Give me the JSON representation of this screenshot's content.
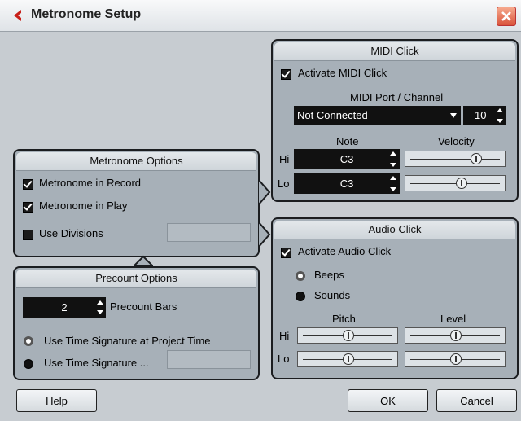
{
  "window": {
    "title": "Metronome Setup"
  },
  "metronome_options": {
    "header": "Metronome Options",
    "record": {
      "label": "Metronome in Record",
      "checked": true
    },
    "play": {
      "label": "Metronome in Play",
      "checked": true
    },
    "divisions": {
      "label": "Use Divisions",
      "checked": false
    }
  },
  "precount_options": {
    "header": "Precount Options",
    "bars_value": "2",
    "bars_label": "Precount Bars",
    "project_time": {
      "label": "Use Time Signature at Project Time",
      "selected": false
    },
    "time_sig": {
      "label": "Use Time Signature ...",
      "selected": true
    }
  },
  "midi_click": {
    "header": "MIDI Click",
    "activate": {
      "label": "Activate MIDI Click",
      "checked": true
    },
    "port_label": "MIDI Port / Channel",
    "port_value": "Not Connected",
    "channel_value": "10",
    "note_label": "Note",
    "velocity_label": "Velocity",
    "hi_label": "Hi",
    "lo_label": "Lo",
    "hi_note": "C3",
    "lo_note": "C3"
  },
  "audio_click": {
    "header": "Audio Click",
    "activate": {
      "label": "Activate Audio Click",
      "checked": true
    },
    "beeps": {
      "label": "Beeps",
      "selected": false
    },
    "sounds": {
      "label": "Sounds",
      "selected": true
    },
    "pitch_label": "Pitch",
    "level_label": "Level",
    "hi_label": "Hi",
    "lo_label": "Lo"
  },
  "buttons": {
    "help": "Help",
    "ok": "OK",
    "cancel": "Cancel"
  }
}
